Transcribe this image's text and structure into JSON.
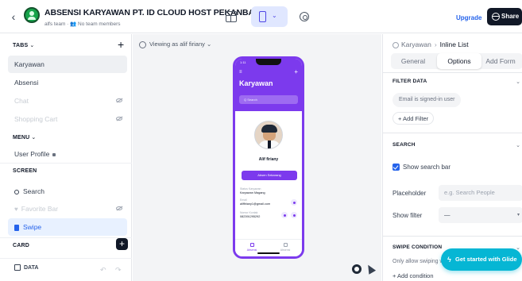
{
  "header": {
    "back_glyph": "‹",
    "app_title": "ABSENSI KARYAWAN PT. ID CLOUD HOST PEKANBARU",
    "app_subtitle": "alfs team · 👥 No team members",
    "upgrade_label": "Upgrade",
    "share_label": "Share",
    "device_chevron": "⌄"
  },
  "sidebar": {
    "tabs_header": "TABS",
    "menu_header": "MENU",
    "screen_header": "SCREEN",
    "card_header": "CARD",
    "chev": "⌄",
    "plus": "+",
    "tabs": [
      {
        "label": "Karyawan"
      },
      {
        "label": "Absensi"
      },
      {
        "label": "Chat"
      },
      {
        "label": "Shopping Cart"
      }
    ],
    "menu_items": [
      {
        "label": "User Profile"
      }
    ],
    "screen_items": [
      {
        "label": "Search"
      },
      {
        "label": "Favorite Bar"
      },
      {
        "label": "Swipe"
      }
    ],
    "data_label": "DATA",
    "undo_glyph": "↶",
    "redo_glyph": "↷"
  },
  "canvas": {
    "viewing_label": "Viewing as alif firiany",
    "viewing_chev": "⌄",
    "phone": {
      "time": "1:11",
      "menu_glyph": "≡",
      "plus_glyph": "+",
      "title": "Karyawan",
      "search_placeholder": "Q Search",
      "name": "Alif firiany",
      "button_label": "Absen Sekarang",
      "fields": [
        {
          "label": "Status Karyawan",
          "value": "Karyawan Magang"
        },
        {
          "label": "Email",
          "value": "aliffiriany1@gmail.com"
        },
        {
          "label": "Nomor Kontak",
          "value": "082391295292"
        }
      ],
      "nav": [
        {
          "label": "Absensi"
        },
        {
          "label": "Absensi"
        }
      ]
    }
  },
  "right_panel": {
    "crumb_parent": "Karyawan",
    "crumb_sep": "›",
    "crumb_current": "Inline List",
    "tabs": [
      {
        "label": "General"
      },
      {
        "label": "Options"
      },
      {
        "label": "Add Form"
      }
    ],
    "filter_header": "FILTER DATA",
    "filter_chip": "Email is signed-in user",
    "add_filter": "+ Add Filter",
    "search_header": "SEARCH",
    "show_search_bar": "Show search bar",
    "show_search_bar_checked": true,
    "placeholder_label": "Placeholder",
    "placeholder_placeholder": "e.g. Search People",
    "show_filter_label": "Show filter",
    "show_filter_value": "—",
    "swipe_header": "SWIPE CONDITION",
    "swipe_desc": "Only allow swiping w",
    "add_condition": "+ Add condition",
    "collapse_glyph": "⌄",
    "dropdown_glyph": "▾"
  },
  "cta": {
    "label": "Get started with Glide",
    "bolt": "ϟ"
  },
  "colors": {
    "accent": "#2563eb",
    "app_purple": "#7c3aed",
    "cta_cyan": "#06b6d4",
    "logo_green": "#16a34a"
  }
}
